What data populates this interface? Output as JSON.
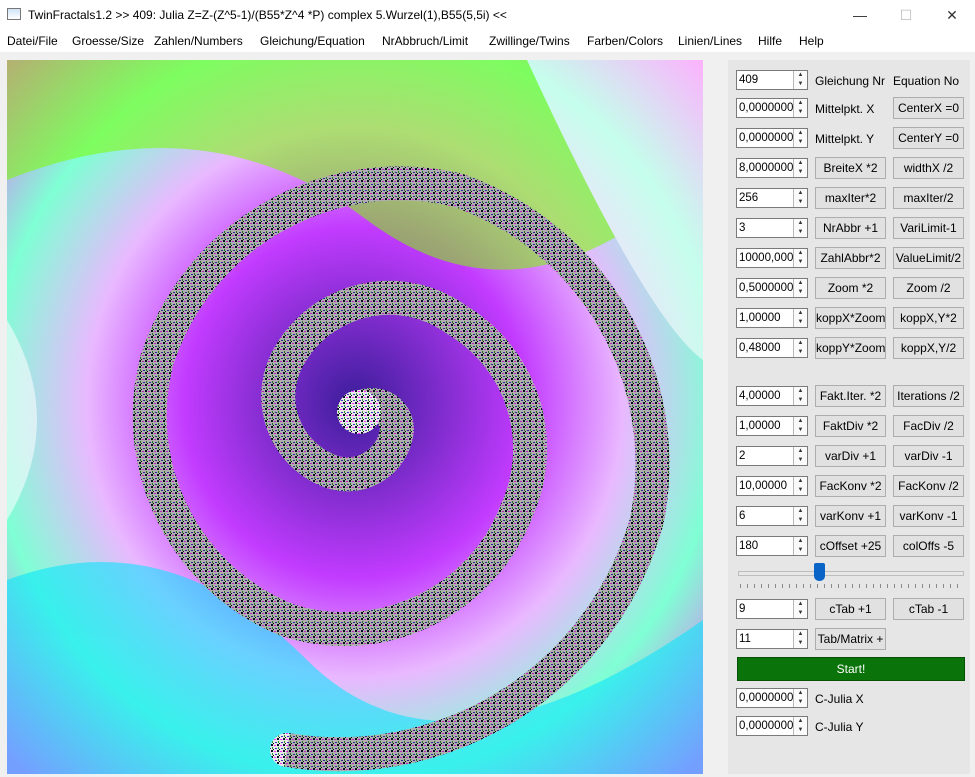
{
  "window": {
    "title": "TwinFractals1.2 >> 409: Julia Z=Z-(Z^5-1)/(B55*Z^4 *P) complex 5.Wurzel(1),B55(5,5i) <<",
    "minimize": "—",
    "maximize": "☐",
    "close": "✕"
  },
  "menu": [
    "Datei/File",
    "Groesse/Size",
    "Zahlen/Numbers",
    "Gleichung/Equation",
    "NrAbbruch/Limit",
    "Zwillinge/Twins",
    "Farben/Colors",
    "Linien/Lines",
    "Hilfe",
    "Help"
  ],
  "controls": {
    "equation": {
      "value": "409",
      "label": "Gleichung Nr",
      "label2": "Equation No"
    },
    "centerx": {
      "value": "0,0000000",
      "label": "Mittelpkt. X",
      "button": "CenterX =0"
    },
    "centery": {
      "value": "0,0000000",
      "label": "Mittelpkt. Y",
      "button": "CenterY =0"
    },
    "width": {
      "value": "8,0000000",
      "button1": "BreiteX *2",
      "button2": "widthX /2"
    },
    "maxiter": {
      "value": "256",
      "button1": "maxIter*2",
      "button2": "maxIter/2"
    },
    "nrabbr": {
      "value": "3",
      "button1": "NrAbbr +1",
      "button2": "VariLimit-1"
    },
    "zahlabbr": {
      "value": "10000,000",
      "button1": "ZahlAbbr*2",
      "button2": "ValueLimit/2"
    },
    "zoom": {
      "value": "0,5000000",
      "button1": "Zoom *2",
      "button2": "Zoom /2"
    },
    "koppx": {
      "value": "1,00000",
      "button1": "koppX*Zoom",
      "button2": "koppX,Y*2"
    },
    "koppy": {
      "value": "0,48000",
      "button1": "koppY*Zoom",
      "button2": "koppX,Y/2"
    },
    "faktiter": {
      "value": "4,00000",
      "button1": "Fakt.Iter. *2",
      "button2": "Iterations /2"
    },
    "faktdiv": {
      "value": "1,00000",
      "button1": "FaktDiv *2",
      "button2": "FacDiv /2"
    },
    "vardiv": {
      "value": "2",
      "button1": "varDiv +1",
      "button2": "varDiv -1"
    },
    "fackonv": {
      "value": "10,00000",
      "button1": "FacKonv *2",
      "button2": "FacKonv /2"
    },
    "varkonv": {
      "value": "6",
      "button1": "varKonv +1",
      "button2": "varKonv -1"
    },
    "coffset": {
      "value": "180",
      "button1": "cOffset +25",
      "button2": "colOffs -5"
    },
    "slider": {
      "value": 0.36
    },
    "ctab": {
      "value": "9",
      "button1": "cTab +1",
      "button2": "cTab -1"
    },
    "tabmatrix": {
      "value": "11",
      "button": "Tab/Matrix +"
    },
    "start": "Start!",
    "cjuliax": {
      "value": "0,0000000",
      "label": "C-Julia X"
    },
    "cjuliay": {
      "value": "0,0000000",
      "label": "C-Julia Y"
    }
  },
  "colors": {
    "start_bg": "#0a740a",
    "slider": "#0a64c8",
    "fractal": [
      "#ff00ff",
      "#8a2be2",
      "#00ff7f",
      "#00ffff",
      "#ffffff",
      "#000000"
    ]
  }
}
